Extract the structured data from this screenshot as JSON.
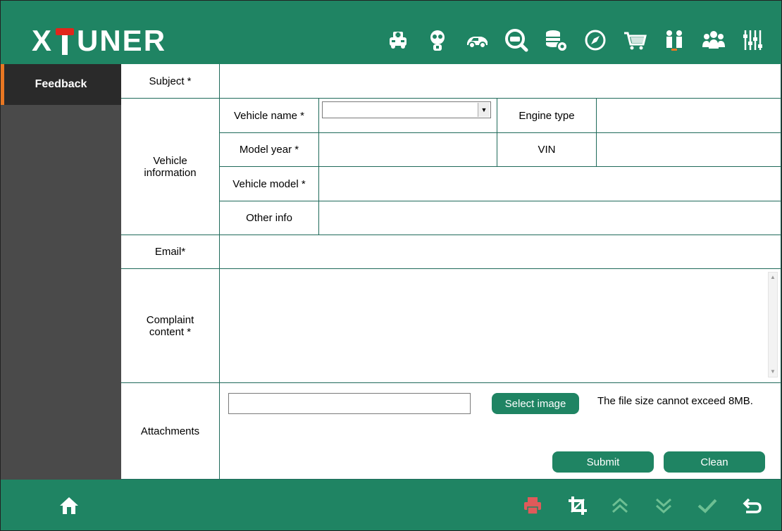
{
  "app": {
    "logo_left": "X",
    "logo_right": "UNER"
  },
  "topbar": {
    "icons": [
      "car-diagnosis-icon",
      "technician-icon",
      "car-icon",
      "search-car-icon",
      "database-settings-icon",
      "compass-icon",
      "shopping-cart-icon",
      "people-icon",
      "group-icon",
      "settings-sliders-icon"
    ]
  },
  "sidebar": {
    "items": [
      {
        "label": "Feedback"
      }
    ]
  },
  "form": {
    "subject_label": "Subject *",
    "vehicle_info_label": "Vehicle information",
    "vehicle_name_label": "Vehicle name *",
    "vehicle_name_value": "",
    "engine_type_label": "Engine type",
    "model_year_label": "Model year *",
    "vin_label": "VIN",
    "vehicle_model_label": "Vehicle model *",
    "other_info_label": "Other info",
    "email_label": "Email*",
    "complaint_label": "Complaint content *",
    "attachments_label": "Attachments",
    "select_image_label": "Select image",
    "file_size_note": "The file size cannot exceed 8MB.",
    "submit_label": "Submit",
    "clean_label": "Clean"
  },
  "bottombar": {
    "icons": [
      "home-icon",
      "print-icon",
      "crop-icon",
      "page-up-icon",
      "page-down-icon",
      "confirm-icon",
      "back-icon"
    ]
  },
  "colors": {
    "brand_green": "#1f8463",
    "accent_orange": "#e87722",
    "logo_red": "#e1251b",
    "sidebar": "#4a4a4a"
  }
}
